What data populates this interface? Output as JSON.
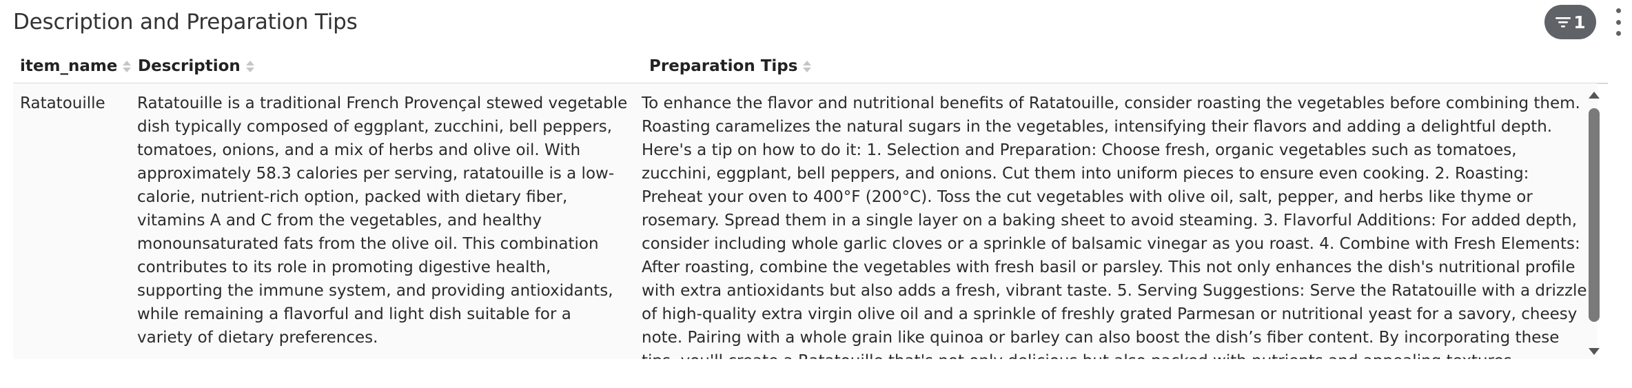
{
  "panel": {
    "title": "Description and Preparation Tips",
    "filter_count": "1"
  },
  "table": {
    "columns": [
      "item_name",
      "Description",
      "Preparation Tips"
    ],
    "rows": [
      {
        "item_name": "Ratatouille",
        "description": "Ratatouille is a traditional French Provençal stewed vegetable dish typically composed of eggplant, zucchini, bell peppers, tomatoes, onions, and a mix of herbs and olive oil. With approximately 58.3 calories per serving, ratatouille is a low-calorie, nutrient-rich option, packed with dietary fiber, vitamins A and C from the vegetables, and healthy monounsaturated fats from the olive oil. This combination contributes to its role in promoting digestive health, supporting the immune system, and providing antioxidants, while remaining a flavorful and light dish suitable for a variety of dietary preferences.",
        "preparation_tips": "To enhance the flavor and nutritional benefits of Ratatouille, consider roasting the vegetables before combining them. Roasting caramelizes the natural sugars in the vegetables, intensifying their flavors and adding a delightful depth. Here's a tip on how to do it: 1. Selection and Preparation: Choose fresh, organic vegetables such as tomatoes, zucchini, eggplant, bell peppers, and onions. Cut them into uniform pieces to ensure even cooking. 2. Roasting: Preheat your oven to 400°F (200°C). Toss the cut vegetables with olive oil, salt, pepper, and herbs like thyme or rosemary. Spread them in a single layer on a baking sheet to avoid steaming. 3. Flavorful Additions: For added depth, consider including whole garlic cloves or a sprinkle of balsamic vinegar as you roast. 4. Combine with Fresh Elements: After roasting, combine the vegetables with fresh basil or parsley. This not only enhances the dish's nutritional profile with extra antioxidants but also adds a fresh, vibrant taste. 5. Serving Suggestions: Serve the Ratatouille with a drizzle of high-quality extra virgin olive oil and a sprinkle of freshly grated Parmesan or nutritional yeast for a savory, cheesy note. Pairing with a whole grain like quinoa or barley can also boost the dish’s fiber content. By incorporating these tips, you'll create a Ratatouille that's not only delicious but also packed with nutrients and appealing textures."
      }
    ]
  },
  "icons": {
    "filter": "filter-icon",
    "menu": "kebab-menu-icon",
    "sort": "sort-icon",
    "scroll_up": "arrow-up-icon",
    "scroll_down": "arrow-down-icon"
  },
  "colors": {
    "filter_pill": "#5f6368",
    "row_background": "#fafafa",
    "scroll_thumb": "#7a7a7a"
  }
}
